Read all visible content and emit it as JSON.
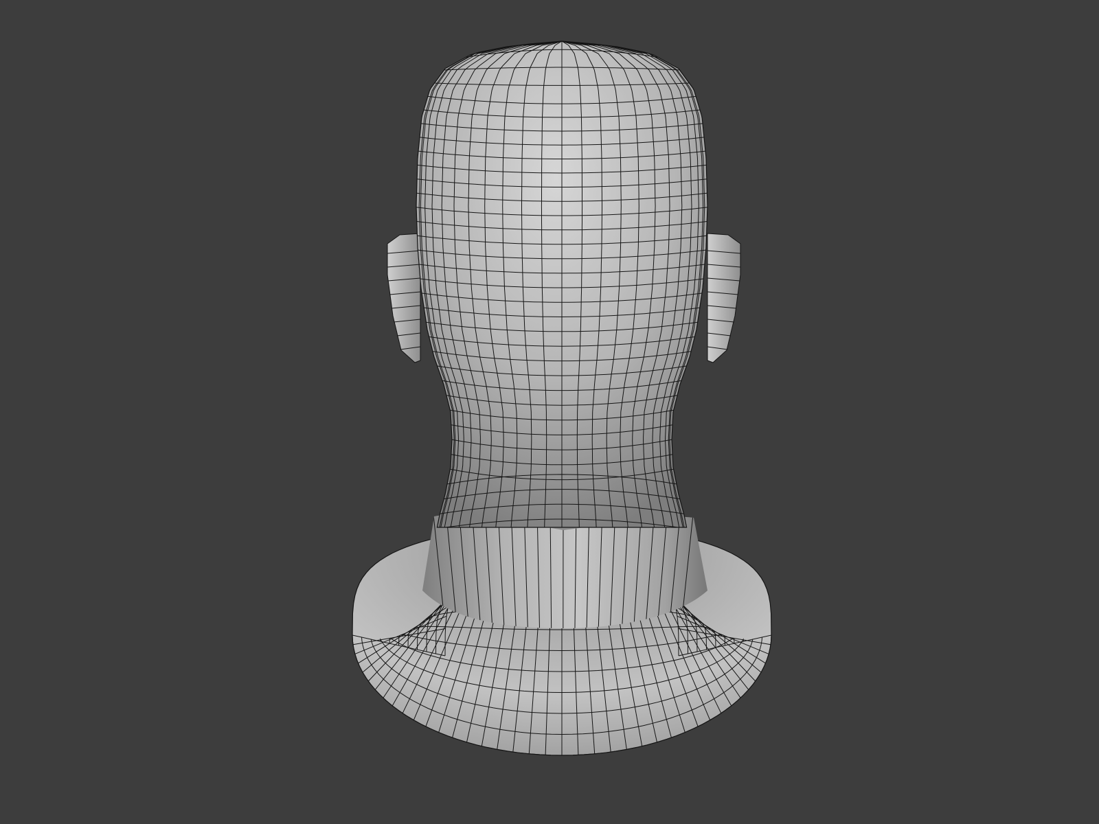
{
  "viewport": {
    "background_color": "#3d3d3d",
    "model": {
      "subject": "head-and-neck-bust",
      "view": "back",
      "shading": "matcap-grey",
      "wireframe": true,
      "surface_color": "#b9b9b9",
      "highlight_color": "#d6d6d6",
      "shadow_color": "#7e7e7e",
      "wire_color": "#141414"
    }
  }
}
